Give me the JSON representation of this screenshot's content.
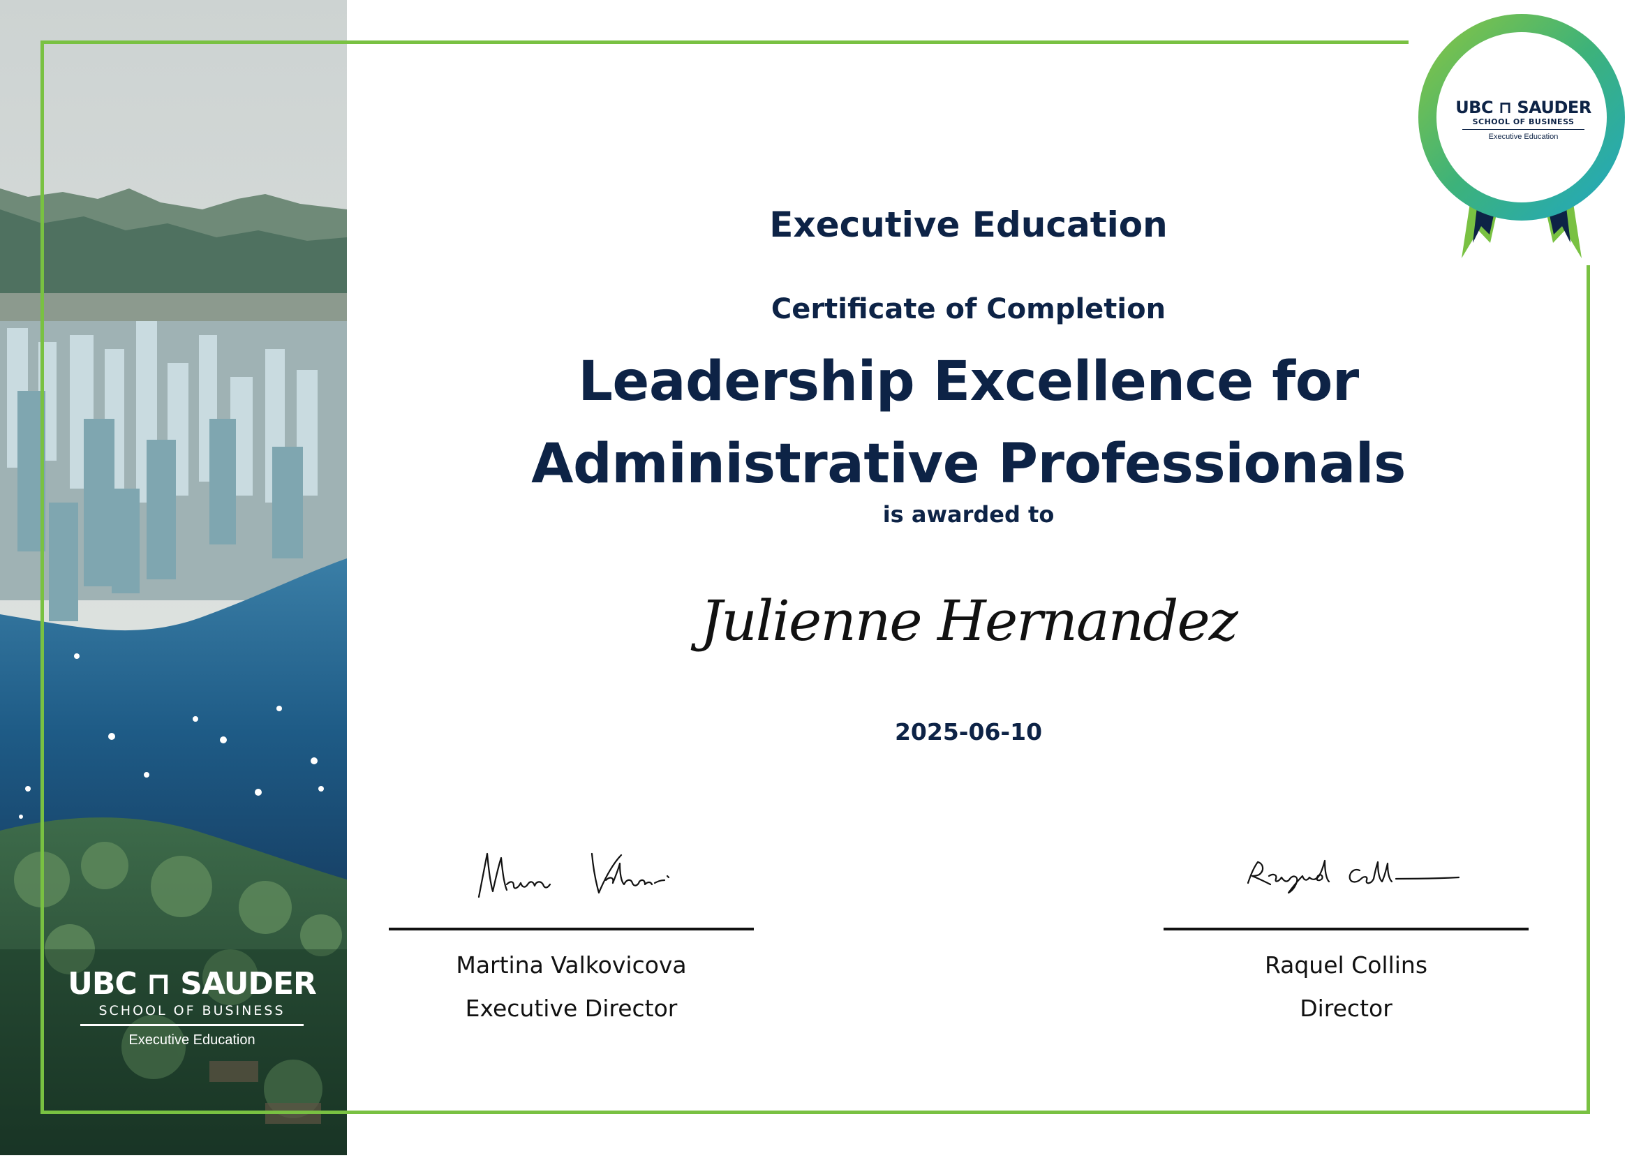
{
  "certificate": {
    "program": "Executive Education",
    "certificate_type": "Certificate of Completion",
    "course_title": "Leadership Excellence for Administrative Professionals",
    "awarded_text": "is awarded to",
    "recipient": "Julienne Hernandez",
    "date": "2025-06-10"
  },
  "left_logo": {
    "line1": "UBC ⊓ SAUDER",
    "line2": "SCHOOL OF BUSINESS",
    "line3": "Executive Education"
  },
  "seal": {
    "line1": "UBC ⊓ SAUDER",
    "line2": "SCHOOL OF BUSINESS",
    "line3": "Executive Education"
  },
  "signatories": [
    {
      "name": "Martina Valkovicova",
      "title": "Executive Director"
    },
    {
      "name": "Raquel Collins",
      "title": "Director"
    }
  ],
  "colors": {
    "navy": "#0d2346",
    "green": "#79c142",
    "teal": "#1fa7c4"
  }
}
